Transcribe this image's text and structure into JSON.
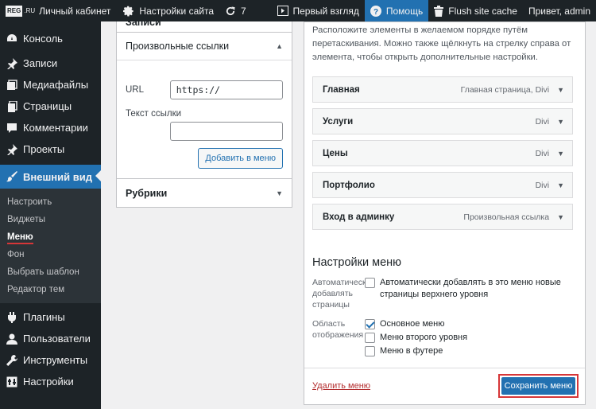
{
  "adminbar": {
    "logo": "REG",
    "logo_suffix": ".RU",
    "cabinet": "Личный кабинет",
    "site_settings": "Настройки сайта",
    "updates_count": "7",
    "first_look": "Первый взгляд",
    "help": "Помощь",
    "flush_cache": "Flush site cache",
    "greeting": "Привет, admin"
  },
  "sidebar": {
    "items": [
      {
        "label": "Консоль",
        "icon": "dashboard-icon"
      },
      {
        "label": "Записи",
        "icon": "pin-icon"
      },
      {
        "label": "Медиафайлы",
        "icon": "media-icon"
      },
      {
        "label": "Страницы",
        "icon": "pages-icon"
      },
      {
        "label": "Комментарии",
        "icon": "comments-icon"
      },
      {
        "label": "Проекты",
        "icon": "pin-icon"
      },
      {
        "label": "Внешний вид",
        "icon": "brush-icon"
      }
    ],
    "submenu": [
      "Настроить",
      "Виджеты",
      "Меню",
      "Фон",
      "Выбрать шаблон",
      "Редактор тем"
    ],
    "items_bottom": [
      {
        "label": "Плагины",
        "icon": "plugin-icon"
      },
      {
        "label": "Пользователи",
        "icon": "users-icon"
      },
      {
        "label": "Инструменты",
        "icon": "tools-icon"
      },
      {
        "label": "Настройки",
        "icon": "settings-icon"
      }
    ]
  },
  "left": {
    "cut_title": "Записи",
    "custom_links_title": "Произвольные ссылки",
    "url_label": "URL",
    "url_value": "https://",
    "link_text_label": "Текст ссылки",
    "link_text_value": "",
    "add_button": "Добавить в меню",
    "categories_title": "Рубрики"
  },
  "right": {
    "instructions": "Расположите элементы в желаемом порядке путём перетаскивания. Можно также щёлкнуть на стрелку справа от элемента, чтобы открыть дополнительные настройки.",
    "menu_items": [
      {
        "title": "Главная",
        "type": "Главная страница, Divi"
      },
      {
        "title": "Услуги",
        "type": "Divi"
      },
      {
        "title": "Цены",
        "type": "Divi"
      },
      {
        "title": "Портфолио",
        "type": "Divi"
      },
      {
        "title": "Вход в админку",
        "type": "Произвольная ссылка"
      }
    ],
    "settings_title": "Настройки меню",
    "auto_add_label": "Автоматически добавлять страницы",
    "auto_add_option": "Автоматически добавлять в это меню новые страницы верхнего уровня",
    "auto_add_checked": false,
    "display_label": "Область отображения",
    "locations": [
      {
        "label": "Основное меню",
        "checked": true
      },
      {
        "label": "Меню второго уровня",
        "checked": false
      },
      {
        "label": "Меню в футере",
        "checked": false
      }
    ],
    "delete_link": "Удалить меню",
    "save_button": "Сохранить меню"
  },
  "colors": {
    "accent": "#2271b1",
    "highlight": "#d63638",
    "sidebar_bg": "#1d2327"
  }
}
